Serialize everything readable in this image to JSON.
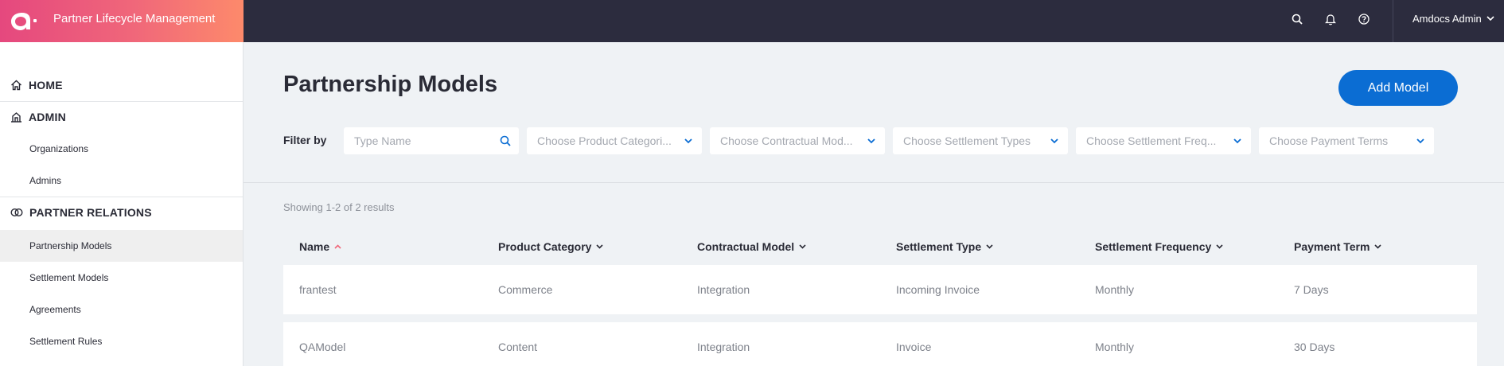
{
  "app": {
    "title": "Partner Lifecycle Management"
  },
  "header": {
    "user_name": "Amdocs Admin"
  },
  "sidebar": {
    "home": "HOME",
    "admin": "ADMIN",
    "admin_items": [
      "Organizations",
      "Admins"
    ],
    "partner_relations": "PARTNER RELATIONS",
    "partner_items": [
      "Partnership Models",
      "Settlement Models",
      "Agreements",
      "Settlement Rules"
    ]
  },
  "main": {
    "title": "Partnership Models",
    "add_button": "Add Model",
    "filter_label": "Filter by",
    "filters": {
      "name_placeholder": "Type Name",
      "product_category": "Choose Product Categori...",
      "contractual_model": "Choose Contractual Mod...",
      "settlement_types": "Choose Settlement Types",
      "settlement_frequency": "Choose Settlement Freq...",
      "payment_terms": "Choose Payment Terms"
    },
    "results_text": "Showing 1-2 of 2 results",
    "columns": [
      "Name",
      "Product Category",
      "Contractual Model",
      "Settlement Type",
      "Settlement Frequency",
      "Payment Term"
    ],
    "rows": [
      [
        "frantest",
        "Commerce",
        "Integration",
        "Incoming Invoice",
        "Monthly",
        "7 Days"
      ],
      [
        "QAModel",
        "Content",
        "Integration",
        "Invoice",
        "Monthly",
        "30 Days"
      ]
    ]
  },
  "colors": {
    "brand_start": "#e5487e",
    "brand_end": "#fd8a6b",
    "topbar": "#2c2c3e",
    "primary_button": "#0b6dd3",
    "sort_active": "#f0677a"
  }
}
